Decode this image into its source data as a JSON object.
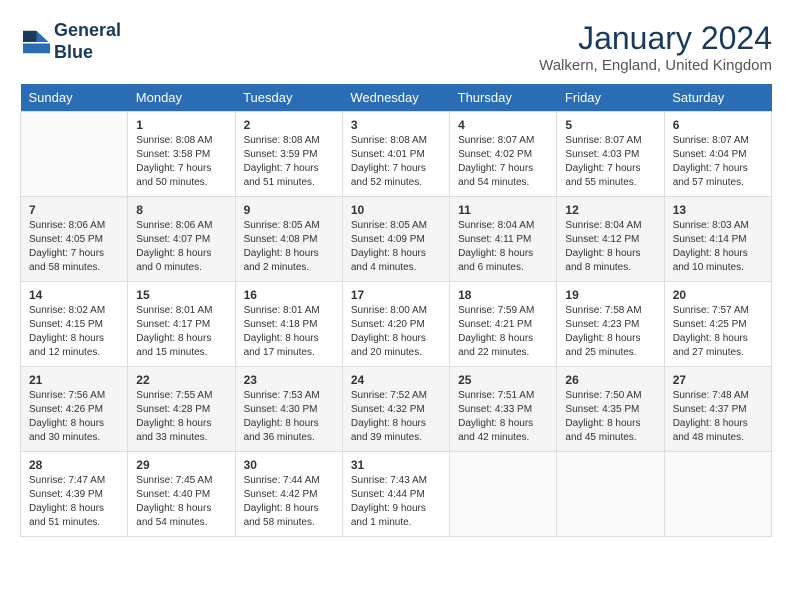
{
  "header": {
    "logo_line1": "General",
    "logo_line2": "Blue",
    "month": "January 2024",
    "location": "Walkern, England, United Kingdom"
  },
  "days_header": [
    "Sunday",
    "Monday",
    "Tuesday",
    "Wednesday",
    "Thursday",
    "Friday",
    "Saturday"
  ],
  "weeks": [
    [
      {
        "day": "",
        "sunrise": "",
        "sunset": "",
        "daylight": ""
      },
      {
        "day": "1",
        "sunrise": "8:08 AM",
        "sunset": "3:58 PM",
        "daylight": "7 hours and 50 minutes."
      },
      {
        "day": "2",
        "sunrise": "8:08 AM",
        "sunset": "3:59 PM",
        "daylight": "7 hours and 51 minutes."
      },
      {
        "day": "3",
        "sunrise": "8:08 AM",
        "sunset": "4:01 PM",
        "daylight": "7 hours and 52 minutes."
      },
      {
        "day": "4",
        "sunrise": "8:07 AM",
        "sunset": "4:02 PM",
        "daylight": "7 hours and 54 minutes."
      },
      {
        "day": "5",
        "sunrise": "8:07 AM",
        "sunset": "4:03 PM",
        "daylight": "7 hours and 55 minutes."
      },
      {
        "day": "6",
        "sunrise": "8:07 AM",
        "sunset": "4:04 PM",
        "daylight": "7 hours and 57 minutes."
      }
    ],
    [
      {
        "day": "7",
        "sunrise": "8:06 AM",
        "sunset": "4:05 PM",
        "daylight": "7 hours and 58 minutes."
      },
      {
        "day": "8",
        "sunrise": "8:06 AM",
        "sunset": "4:07 PM",
        "daylight": "8 hours and 0 minutes."
      },
      {
        "day": "9",
        "sunrise": "8:05 AM",
        "sunset": "4:08 PM",
        "daylight": "8 hours and 2 minutes."
      },
      {
        "day": "10",
        "sunrise": "8:05 AM",
        "sunset": "4:09 PM",
        "daylight": "8 hours and 4 minutes."
      },
      {
        "day": "11",
        "sunrise": "8:04 AM",
        "sunset": "4:11 PM",
        "daylight": "8 hours and 6 minutes."
      },
      {
        "day": "12",
        "sunrise": "8:04 AM",
        "sunset": "4:12 PM",
        "daylight": "8 hours and 8 minutes."
      },
      {
        "day": "13",
        "sunrise": "8:03 AM",
        "sunset": "4:14 PM",
        "daylight": "8 hours and 10 minutes."
      }
    ],
    [
      {
        "day": "14",
        "sunrise": "8:02 AM",
        "sunset": "4:15 PM",
        "daylight": "8 hours and 12 minutes."
      },
      {
        "day": "15",
        "sunrise": "8:01 AM",
        "sunset": "4:17 PM",
        "daylight": "8 hours and 15 minutes."
      },
      {
        "day": "16",
        "sunrise": "8:01 AM",
        "sunset": "4:18 PM",
        "daylight": "8 hours and 17 minutes."
      },
      {
        "day": "17",
        "sunrise": "8:00 AM",
        "sunset": "4:20 PM",
        "daylight": "8 hours and 20 minutes."
      },
      {
        "day": "18",
        "sunrise": "7:59 AM",
        "sunset": "4:21 PM",
        "daylight": "8 hours and 22 minutes."
      },
      {
        "day": "19",
        "sunrise": "7:58 AM",
        "sunset": "4:23 PM",
        "daylight": "8 hours and 25 minutes."
      },
      {
        "day": "20",
        "sunrise": "7:57 AM",
        "sunset": "4:25 PM",
        "daylight": "8 hours and 27 minutes."
      }
    ],
    [
      {
        "day": "21",
        "sunrise": "7:56 AM",
        "sunset": "4:26 PM",
        "daylight": "8 hours and 30 minutes."
      },
      {
        "day": "22",
        "sunrise": "7:55 AM",
        "sunset": "4:28 PM",
        "daylight": "8 hours and 33 minutes."
      },
      {
        "day": "23",
        "sunrise": "7:53 AM",
        "sunset": "4:30 PM",
        "daylight": "8 hours and 36 minutes."
      },
      {
        "day": "24",
        "sunrise": "7:52 AM",
        "sunset": "4:32 PM",
        "daylight": "8 hours and 39 minutes."
      },
      {
        "day": "25",
        "sunrise": "7:51 AM",
        "sunset": "4:33 PM",
        "daylight": "8 hours and 42 minutes."
      },
      {
        "day": "26",
        "sunrise": "7:50 AM",
        "sunset": "4:35 PM",
        "daylight": "8 hours and 45 minutes."
      },
      {
        "day": "27",
        "sunrise": "7:48 AM",
        "sunset": "4:37 PM",
        "daylight": "8 hours and 48 minutes."
      }
    ],
    [
      {
        "day": "28",
        "sunrise": "7:47 AM",
        "sunset": "4:39 PM",
        "daylight": "8 hours and 51 minutes."
      },
      {
        "day": "29",
        "sunrise": "7:45 AM",
        "sunset": "4:40 PM",
        "daylight": "8 hours and 54 minutes."
      },
      {
        "day": "30",
        "sunrise": "7:44 AM",
        "sunset": "4:42 PM",
        "daylight": "8 hours and 58 minutes."
      },
      {
        "day": "31",
        "sunrise": "7:43 AM",
        "sunset": "4:44 PM",
        "daylight": "9 hours and 1 minute."
      },
      {
        "day": "",
        "sunrise": "",
        "sunset": "",
        "daylight": ""
      },
      {
        "day": "",
        "sunrise": "",
        "sunset": "",
        "daylight": ""
      },
      {
        "day": "",
        "sunrise": "",
        "sunset": "",
        "daylight": ""
      }
    ]
  ]
}
